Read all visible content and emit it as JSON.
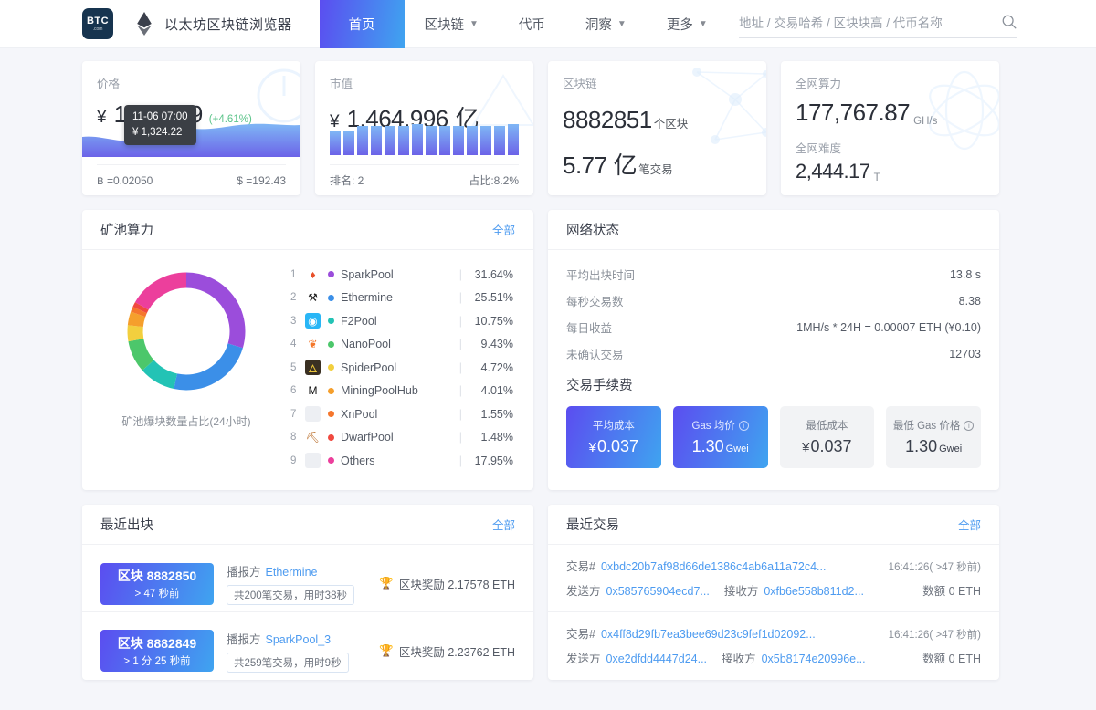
{
  "header": {
    "logo": {
      "line1": "BTC",
      "line2": ".com"
    },
    "eth_icon": "ethereum-diamond-icon",
    "brand_title": "以太坊区块链浏览器",
    "nav": [
      {
        "label": "首页",
        "active": true,
        "caret": false
      },
      {
        "label": "区块链",
        "active": false,
        "caret": true
      },
      {
        "label": "代币",
        "active": false,
        "caret": false
      },
      {
        "label": "洞察",
        "active": false,
        "caret": true
      },
      {
        "label": "更多",
        "active": false,
        "caret": true
      }
    ],
    "search": {
      "placeholder": "地址 / 交易哈希 / 区块块高 / 代币名称",
      "value": "",
      "icon": "search-icon"
    }
  },
  "stats": {
    "price": {
      "label": "价格",
      "currency": "¥",
      "value": "1,349.59",
      "change": "(+4.61%)",
      "tooltip_time": "11-06 07:00",
      "tooltip_value": "¥ 1,324.22",
      "foot_left": "฿ =0.02050",
      "foot_right": "$ =192.43"
    },
    "marketcap": {
      "label": "市值",
      "currency": "¥",
      "value": "1,464.996",
      "unit": "亿",
      "foot_left": "排名: 2",
      "foot_right": "占比:8.2%",
      "bars": [
        62,
        62,
        76,
        76,
        76,
        76,
        82,
        76,
        76,
        76,
        76,
        76,
        76,
        82
      ]
    },
    "blockchain": {
      "label": "区块链",
      "blocks_value": "8882851",
      "blocks_unit": "个区块",
      "tx_value": "5.77",
      "tx_unit_big": "亿",
      "tx_unit": "笔交易"
    },
    "hashrate": {
      "label": "全网算力",
      "value": "177,767.87",
      "unit": "GH/s",
      "difficulty_label": "全网难度",
      "difficulty_value": "2,444.17",
      "difficulty_unit": "T"
    }
  },
  "pool": {
    "title": "矿池算力",
    "all_label": "全部",
    "donut_caption": "矿池爆块数量占比(24小时)",
    "items": [
      {
        "rank": "1",
        "name": "SparkPool",
        "pct": "31.64%",
        "color": "#9b4ddb",
        "glyph": "♦",
        "glyph_color": "#e8502a",
        "glyph_bg": "transparent"
      },
      {
        "rank": "2",
        "name": "Ethermine",
        "pct": "25.51%",
        "color": "#3b8fe8",
        "glyph": "⚒",
        "glyph_color": "#1a1a1a",
        "glyph_bg": "transparent"
      },
      {
        "rank": "3",
        "name": "F2Pool",
        "pct": "10.75%",
        "color": "#23c3b5",
        "glyph": "◉",
        "glyph_color": "#ffffff",
        "glyph_bg": "#29b6f6"
      },
      {
        "rank": "4",
        "name": "NanoPool",
        "pct": "9.43%",
        "color": "#4cc76b",
        "glyph": "❦",
        "glyph_color": "#f4772a",
        "glyph_bg": "transparent"
      },
      {
        "rank": "5",
        "name": "SpiderPool",
        "pct": "4.72%",
        "color": "#f2cf3e",
        "glyph": "🜂",
        "glyph_color": "#e8c33a",
        "glyph_bg": "#3a3022"
      },
      {
        "rank": "6",
        "name": "MiningPoolHub",
        "pct": "4.01%",
        "color": "#f59f2c",
        "glyph": "M",
        "glyph_color": "#111111",
        "glyph_bg": "transparent"
      },
      {
        "rank": "7",
        "name": "XnPool",
        "pct": "1.55%",
        "color": "#f5762c",
        "glyph": "",
        "glyph_color": "#c8ccd4",
        "glyph_bg": "#edeff3"
      },
      {
        "rank": "8",
        "name": "DwarfPool",
        "pct": "1.48%",
        "color": "#f0493f",
        "glyph": "⛏",
        "glyph_color": "#b5651d",
        "glyph_bg": "transparent"
      },
      {
        "rank": "9",
        "name": "Others",
        "pct": "17.95%",
        "color": "#ec3f9c",
        "glyph": "",
        "glyph_color": "#c8ccd4",
        "glyph_bg": "#edeff3"
      }
    ]
  },
  "network": {
    "title": "网络状态",
    "rows": [
      {
        "key": "平均出块时间",
        "value": "13.8 s"
      },
      {
        "key": "每秒交易数",
        "value": "8.38"
      },
      {
        "key": "每日收益",
        "value": "1MH/s * 24H = 0.00007 ETH (¥0.10)"
      },
      {
        "key": "未确认交易",
        "value": "12703"
      }
    ],
    "fee_title": "交易手续费",
    "fees": [
      {
        "label": "平均成本",
        "info": false,
        "currency": "¥",
        "value": "0.037",
        "unit": "",
        "highlight": true
      },
      {
        "label": "Gas 均价",
        "info": true,
        "currency": "",
        "value": "1.30",
        "unit": "Gwei",
        "highlight": true
      },
      {
        "label": "最低成本",
        "info": false,
        "currency": "¥",
        "value": "0.037",
        "unit": "",
        "highlight": false
      },
      {
        "label": "最低 Gas 价格",
        "info": true,
        "currency": "",
        "value": "1.30",
        "unit": "Gwei",
        "highlight": false
      }
    ]
  },
  "blocks": {
    "title": "最近出块",
    "all_label": "全部",
    "items": [
      {
        "prefix": "区块",
        "number": "8882850",
        "time": "> 47 秒前",
        "caster_label": "播报方",
        "caster": "Ethermine",
        "tx_info": "共200笔交易，用时38秒",
        "reward_icon": "trophy-icon",
        "reward_label": "区块奖励",
        "reward": "2.17578 ETH"
      },
      {
        "prefix": "区块",
        "number": "8882849",
        "time": "> 1 分 25 秒前",
        "caster_label": "播报方",
        "caster": "SparkPool_3",
        "tx_info": "共259笔交易，用时9秒",
        "reward_icon": "trophy-icon",
        "reward_label": "区块奖励",
        "reward": "2.23762 ETH"
      }
    ]
  },
  "transactions": {
    "title": "最近交易",
    "all_label": "全部",
    "items": [
      {
        "tx_label": "交易#",
        "hash": "0xbdc20b7af98d66de1386c4ab6a11a72c4...",
        "time": "16:41:26( >47 秒前)",
        "from_label": "发送方",
        "from": "0x585765904ecd7...",
        "to_label": "接收方",
        "to": "0xfb6e558b811d2...",
        "amount_label": "数额",
        "amount": "0 ETH"
      },
      {
        "tx_label": "交易#",
        "hash": "0x4ff8d29fb7ea3bee69d23c9fef1d02092...",
        "time": "16:41:26( >47 秒前)",
        "from_label": "发送方",
        "from": "0xe2dfdd4447d24...",
        "to_label": "接收方",
        "to": "0x5b8174e20996e...",
        "amount_label": "数额",
        "amount": "0 ETH"
      }
    ]
  },
  "chart_data": {
    "type": "pie",
    "title": "矿池爆块数量占比(24小时)",
    "categories": [
      "SparkPool",
      "Ethermine",
      "F2Pool",
      "NanoPool",
      "SpiderPool",
      "MiningPoolHub",
      "XnPool",
      "DwarfPool",
      "Others"
    ],
    "values": [
      31.64,
      25.51,
      10.75,
      9.43,
      4.72,
      4.01,
      1.55,
      1.48,
      17.95
    ],
    "colors": [
      "#9b4ddb",
      "#3b8fe8",
      "#23c3b5",
      "#4cc76b",
      "#f2cf3e",
      "#f59f2c",
      "#f5762c",
      "#f0493f",
      "#ec3f9c"
    ],
    "legend": "right",
    "donut": true
  }
}
